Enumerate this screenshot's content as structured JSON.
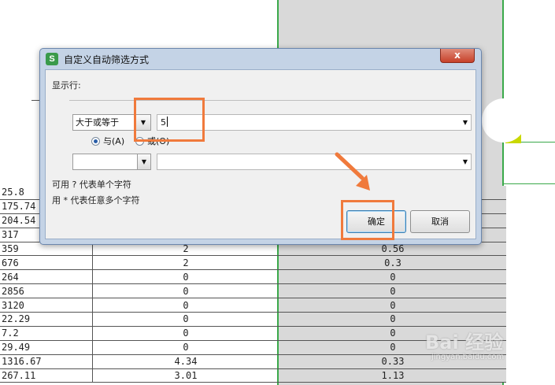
{
  "dialog": {
    "title": "自定义自动筛选方式",
    "app_icon": "S",
    "close_glyph": "x",
    "show_rows_label": "显示行:",
    "condition1": {
      "operator": "大于或等于",
      "value": "5"
    },
    "logic": {
      "and_label": "与(A)",
      "or_label": "或(O)",
      "selected": "and"
    },
    "condition2": {
      "operator": "",
      "value": ""
    },
    "hint_single": "可用 ? 代表单个字符",
    "hint_multi": "用 * 代表任意多个字符",
    "ok_label": "确定",
    "cancel_label": "取消"
  },
  "sheet": {
    "rows": [
      {
        "a": "25.8",
        "b": "",
        "c": ""
      },
      {
        "a": "175.74",
        "b": "",
        "c": ""
      },
      {
        "a": "204.54",
        "b": "",
        "c": ""
      },
      {
        "a": "317",
        "b": "",
        "c": ""
      },
      {
        "a": "359",
        "b": "2",
        "c": "0.56"
      },
      {
        "a": "676",
        "b": "2",
        "c": "0.3"
      },
      {
        "a": "264",
        "b": "0",
        "c": "0"
      },
      {
        "a": "2856",
        "b": "0",
        "c": "0"
      },
      {
        "a": "3120",
        "b": "0",
        "c": "0"
      },
      {
        "a": "22.29",
        "b": "0",
        "c": "0"
      },
      {
        "a": "7.2",
        "b": "0",
        "c": "0"
      },
      {
        "a": "29.49",
        "b": "0",
        "c": "0"
      },
      {
        "a": "1316.67",
        "b": "4.34",
        "c": "0.33"
      },
      {
        "a": "267.11",
        "b": "3.01",
        "c": "1.13"
      }
    ]
  },
  "watermark": {
    "main": "Bai 经验",
    "sub": "jingyan.baidu.com"
  },
  "colors": {
    "accent_orange": "#f07a3c",
    "green_border": "#3aa94a",
    "highlight_yellow": "#c9d800"
  }
}
